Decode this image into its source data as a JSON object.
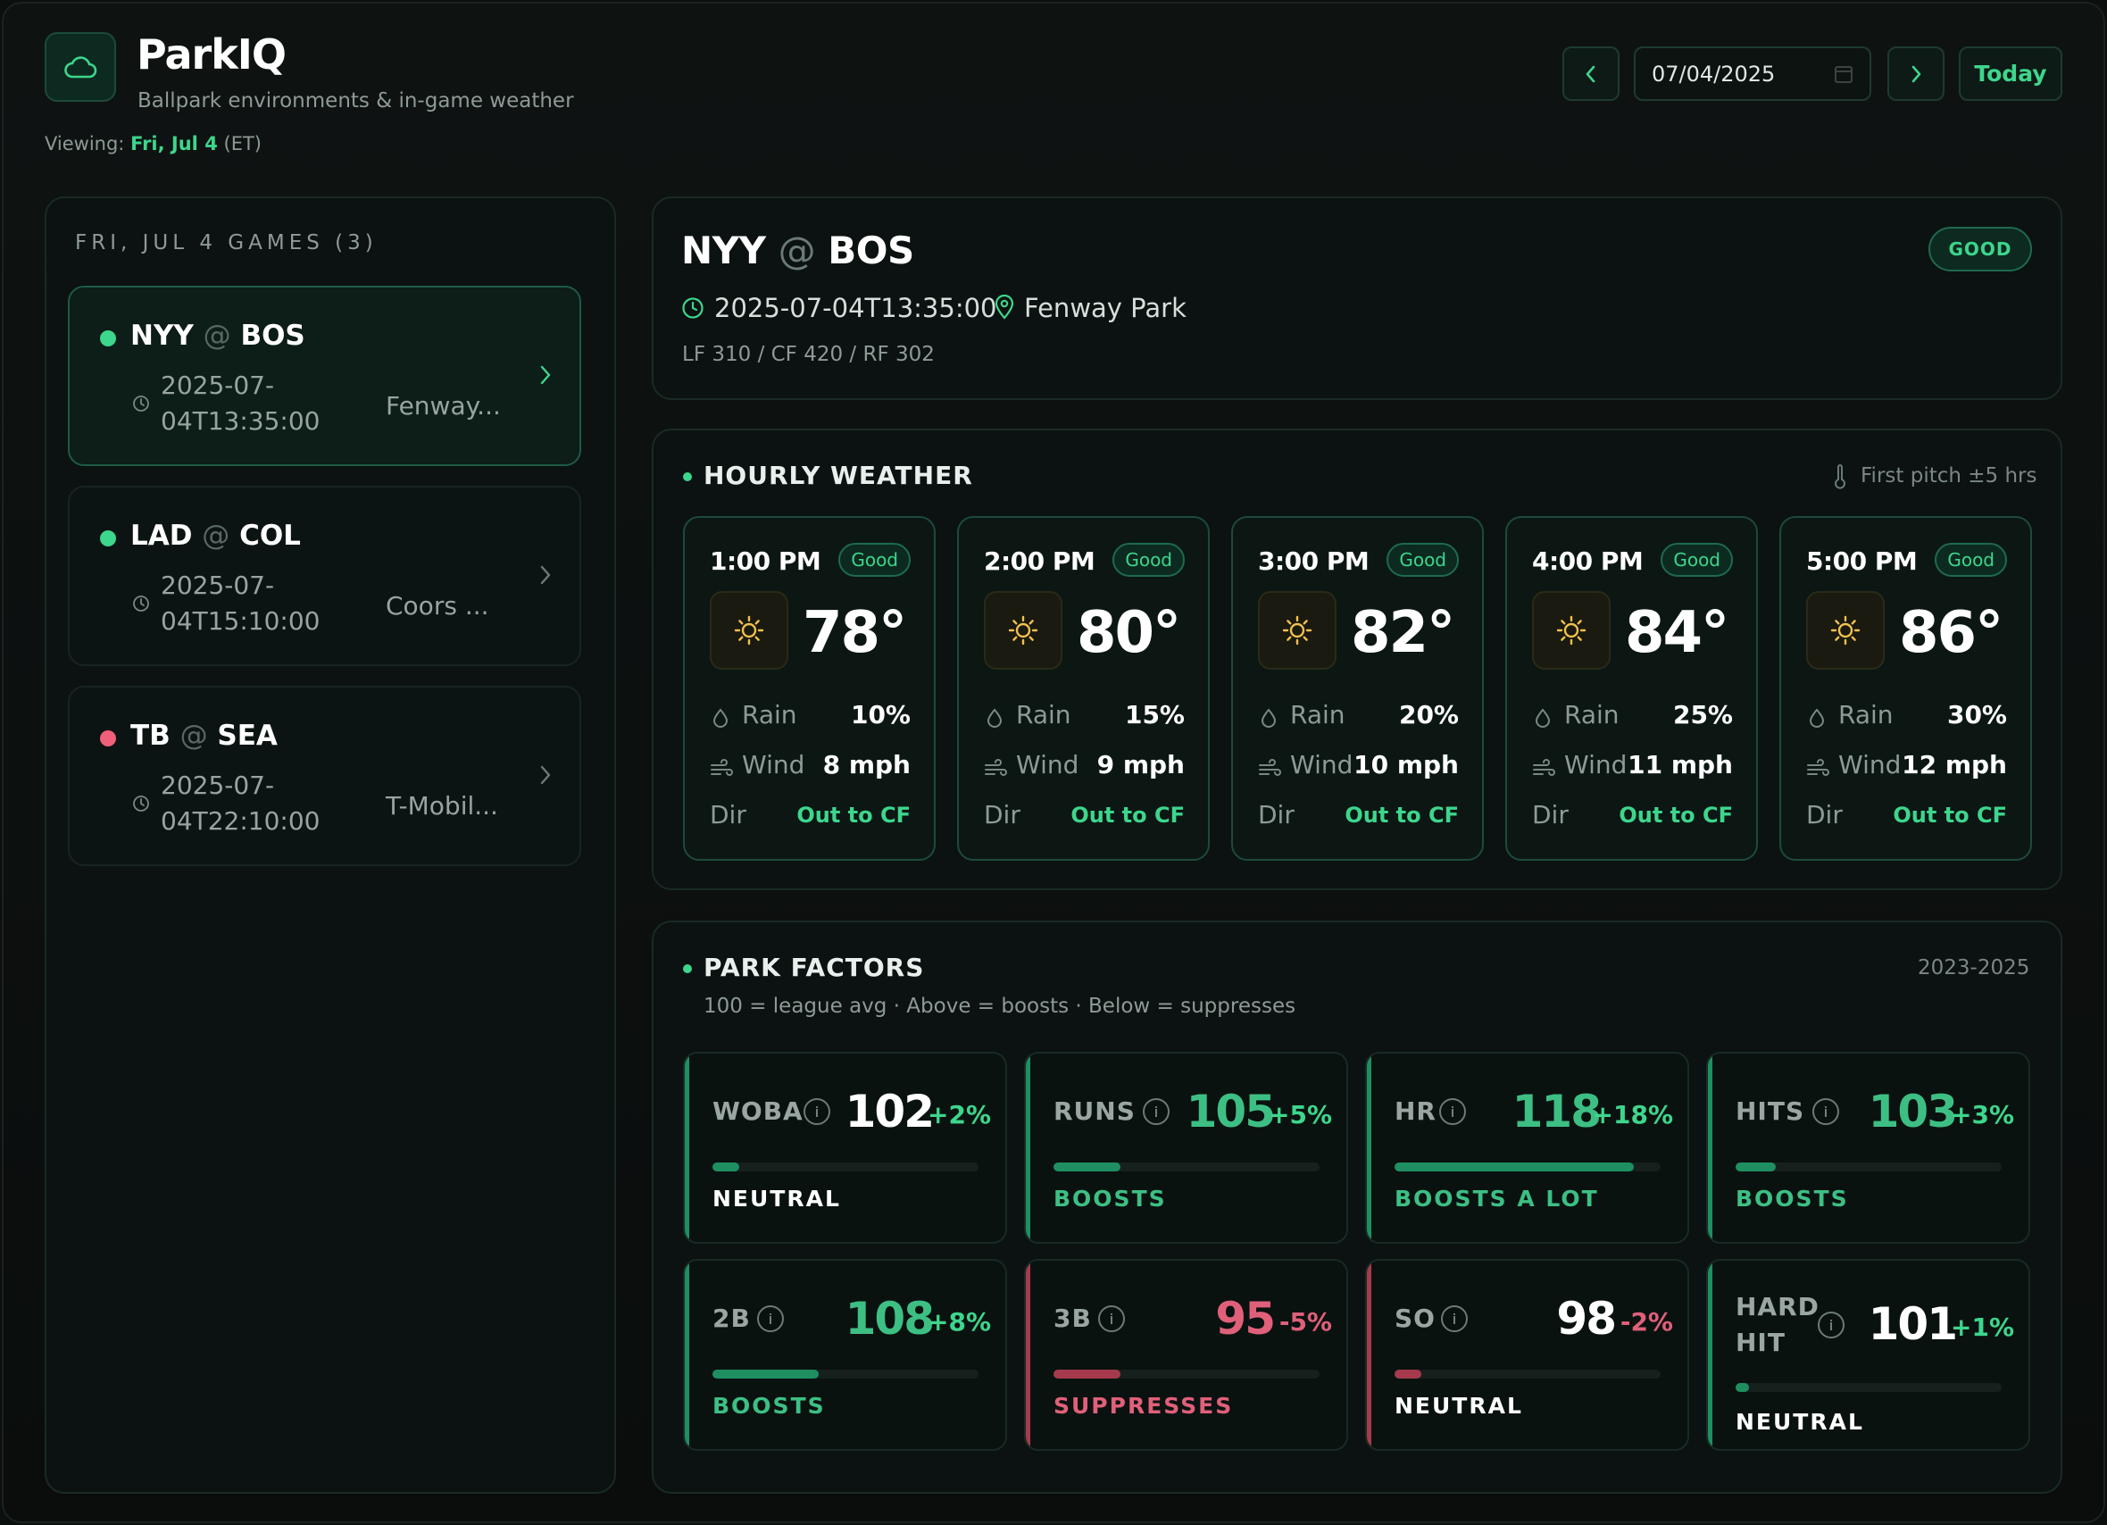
{
  "app": {
    "title": "ParkIQ",
    "subtitle": "Ballpark environments & in-game weather",
    "viewing_label": "Viewing:",
    "viewing_date": "Fri, Jul 4",
    "viewing_tz": "(ET)"
  },
  "toolbar": {
    "date_value": "07/04/2025",
    "today_label": "Today"
  },
  "games_list": {
    "title": "FRI, JUL 4 GAMES (3)",
    "items": [
      {
        "away": "NYY",
        "at": "@",
        "home": "BOS",
        "time_line1": "2025-07-",
        "time_line2": "04T13:35:00",
        "venue": "Fenway...",
        "status_color": "#3dd68c",
        "active": true
      },
      {
        "away": "LAD",
        "at": "@",
        "home": "COL",
        "time_line1": "2025-07-",
        "time_line2": "04T15:10:00",
        "venue": "Coors ...",
        "status_color": "#3dd68c",
        "active": false
      },
      {
        "away": "TB",
        "at": "@",
        "home": "SEA",
        "time_line1": "2025-07-",
        "time_line2": "04T22:10:00",
        "venue": "T-Mobil...",
        "status_color": "#f0607a",
        "active": false
      }
    ]
  },
  "summary": {
    "away": "NYY",
    "at": "@",
    "home": "BOS",
    "badge": "GOOD",
    "datetime": "2025-07-04T13:35:00",
    "venue": "Fenway Park",
    "dimensions": "LF 310 / CF 420 / RF 302"
  },
  "hourly": {
    "title": "HOURLY WEATHER",
    "note": "First pitch ±5 hrs",
    "rain_label": "Rain",
    "wind_label": "Wind",
    "dir_label": "Dir",
    "hours": [
      {
        "time": "1:00 PM",
        "badge": "Good",
        "icon": "sun-icon",
        "temp": "78°",
        "rain": "10%",
        "wind": "8 mph",
        "dir": "Out to CF"
      },
      {
        "time": "2:00 PM",
        "badge": "Good",
        "icon": "sun-icon",
        "temp": "80°",
        "rain": "15%",
        "wind": "9 mph",
        "dir": "Out to CF"
      },
      {
        "time": "3:00 PM",
        "badge": "Good",
        "icon": "sun-icon",
        "temp": "82°",
        "rain": "20%",
        "wind": "10 mph",
        "dir": "Out to CF"
      },
      {
        "time": "4:00 PM",
        "badge": "Good",
        "icon": "sun-icon",
        "temp": "84°",
        "rain": "25%",
        "wind": "11 mph",
        "dir": "Out to CF"
      },
      {
        "time": "5:00 PM",
        "badge": "Good",
        "icon": "sun-icon",
        "temp": "86°",
        "rain": "30%",
        "wind": "12 mph",
        "dir": "Out to CF"
      }
    ]
  },
  "park_factors": {
    "title": "PARK FACTORS",
    "years": "2023-2025",
    "subtitle": "100 = league avg · Above = boosts · Below = suppresses",
    "info_glyph": "i",
    "factors": [
      {
        "name": "WOBA",
        "value": "102",
        "delta": "+2%",
        "verdict": "NEUTRAL",
        "level": 0.1,
        "tone": "neutral-up"
      },
      {
        "name": "RUNS",
        "value": "105",
        "delta": "+5%",
        "verdict": "BOOSTS",
        "level": 0.25,
        "tone": "boost"
      },
      {
        "name": "HR",
        "value": "118",
        "delta": "+18%",
        "verdict": "BOOSTS A LOT",
        "level": 0.9,
        "tone": "boost"
      },
      {
        "name": "HITS",
        "value": "103",
        "delta": "+3%",
        "verdict": "BOOSTS",
        "level": 0.15,
        "tone": "boost"
      },
      {
        "name": "2B",
        "value": "108",
        "delta": "+8%",
        "verdict": "BOOSTS",
        "level": 0.4,
        "tone": "boost"
      },
      {
        "name": "3B",
        "value": "95",
        "delta": "-5%",
        "verdict": "SUPPRESSES",
        "level": 0.25,
        "tone": "suppress"
      },
      {
        "name": "SO",
        "value": "98",
        "delta": "-2%",
        "verdict": "NEUTRAL",
        "level": 0.1,
        "tone": "neutral-down"
      },
      {
        "name": "HARD HIT",
        "value": "101",
        "delta": "+1%",
        "verdict": "NEUTRAL",
        "level": 0.05,
        "tone": "neutral-up"
      }
    ]
  },
  "colors": {
    "accent": "#3dd68c",
    "boost_text": "#3dbf84",
    "boost_bar": "#1f8f62",
    "suppress_text": "#e0607a",
    "suppress_bar": "#a63a4c",
    "neutral_bar": "#1f8f62",
    "neutral_down_bar": "#a63a4c",
    "sun": "#f2c14e"
  }
}
